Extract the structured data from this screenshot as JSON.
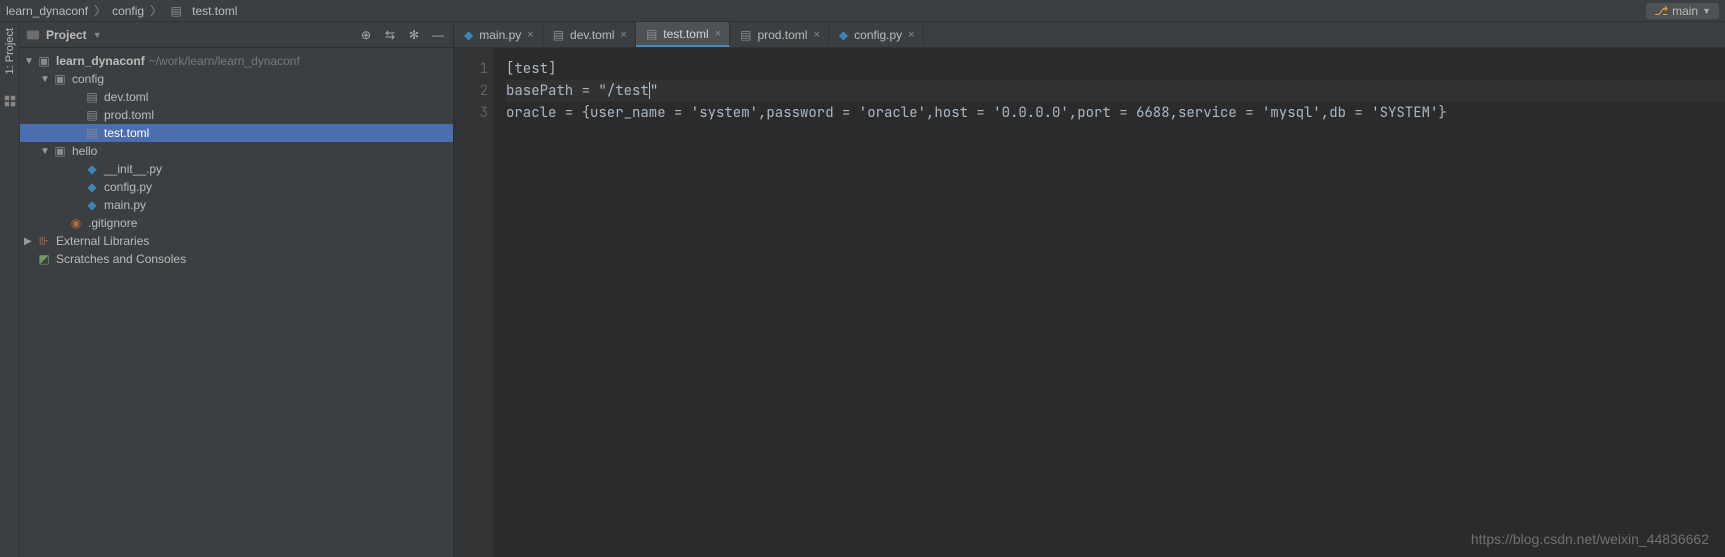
{
  "breadcrumb": [
    "learn_dynaconf",
    "config",
    "test.toml"
  ],
  "branch": {
    "name": "main"
  },
  "project_panel": {
    "title": "Project",
    "tool_window_label": "1: Project"
  },
  "tree": {
    "root": {
      "name": "learn_dynaconf",
      "hint": "~/work/learn/learn_dynaconf"
    },
    "config_folder": "config",
    "config_files": [
      "dev.toml",
      "prod.toml",
      "test.toml"
    ],
    "hello_folder": "hello",
    "hello_files": [
      "__init__.py",
      "config.py",
      "main.py"
    ],
    "gitignore": ".gitignore",
    "external_libs": "External Libraries",
    "scratches": "Scratches and Consoles"
  },
  "tabs": [
    {
      "label": "main.py",
      "type": "py",
      "active": false
    },
    {
      "label": "dev.toml",
      "type": "toml",
      "active": false
    },
    {
      "label": "test.toml",
      "type": "toml",
      "active": true
    },
    {
      "label": "prod.toml",
      "type": "toml",
      "active": false
    },
    {
      "label": "config.py",
      "type": "py",
      "active": false
    }
  ],
  "code": {
    "line1": "[test]",
    "line2_pre": "basePath = \"",
    "line2_val": "/test",
    "line2_post": "\"",
    "line3": "oracle = {user_name = 'system',password = 'oracle',host = '0.0.0.0',port = 6688,service = 'mysql',db = 'SYSTEM'}"
  },
  "gutter": [
    "1",
    "2",
    "3"
  ],
  "watermark": "https://blog.csdn.net/weixin_44836662"
}
